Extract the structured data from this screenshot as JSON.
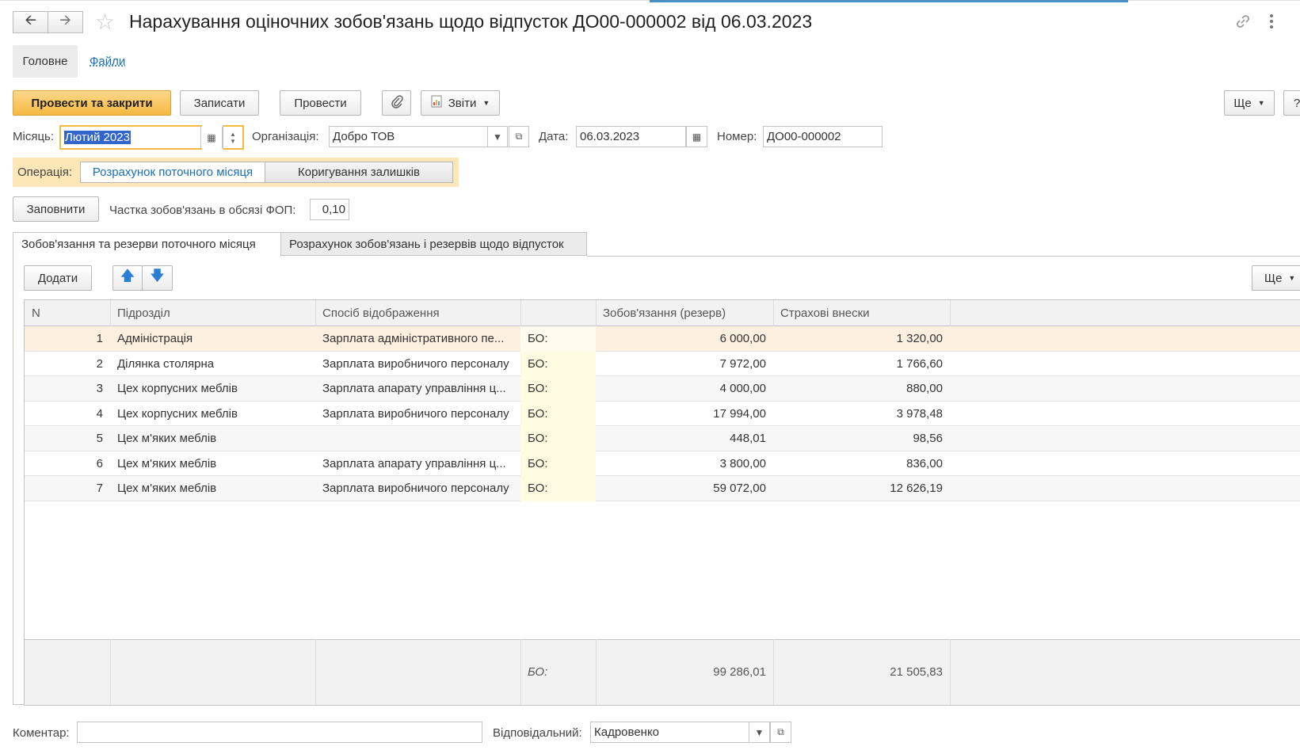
{
  "header": {
    "title": "Нарахування оціночних зобов'язань щодо відпусток ДО00-000002 від 06.03.2023"
  },
  "nav_tabs": [
    "Головне",
    "Файли"
  ],
  "toolbar": {
    "post_close": "Провести та закрити",
    "save": "Записати",
    "post": "Провести",
    "reports": "Звіти",
    "more": "Ще",
    "help": "?"
  },
  "form": {
    "month_label": "Місяць:",
    "month_value": "Лютий 2023",
    "org_label": "Організація:",
    "org_value": "Добро ТОВ",
    "date_label": "Дата:",
    "date_value": "06.03.2023",
    "number_label": "Номер:",
    "number_value": "ДО00-000002",
    "operation_label": "Операція:",
    "operation_options": [
      "Розрахунок поточного місяця",
      "Коригування залишків"
    ],
    "fill_button": "Заповнити",
    "share_label": "Частка зобов'язань в обсязі ФОП:",
    "share_value": "0,10"
  },
  "tabs": [
    "Зобов'язання та резерви поточного місяця",
    "Розрахунок зобов'язань і резервів щодо відпусток"
  ],
  "table_toolbar": {
    "add": "Додати",
    "more": "Ще"
  },
  "table": {
    "columns": [
      "N",
      "Підрозділ",
      "Спосіб відображення",
      "",
      "Зобов'язання (резерв)",
      "Страхові внески"
    ],
    "rows": [
      [
        "1",
        "Адміністрація",
        "Зарплата адміністративного пе...",
        "БО:",
        "6 000,00",
        "1 320,00"
      ],
      [
        "2",
        "Ділянка столярна",
        "Зарплата виробничого персоналу",
        "БО:",
        "7 972,00",
        "1 766,60"
      ],
      [
        "3",
        "Цех корпусних меблів",
        "Зарплата апарату управління ц...",
        "БО:",
        "4 000,00",
        "880,00"
      ],
      [
        "4",
        "Цех корпусних меблів",
        "Зарплата виробничого персоналу",
        "БО:",
        "17 994,00",
        "3 978,48"
      ],
      [
        "5",
        "Цех м'яких меблів",
        "",
        "БО:",
        "448,01",
        "98,56"
      ],
      [
        "6",
        "Цех м'яких меблів",
        "Зарплата апарату управління ц...",
        "БО:",
        "3 800,00",
        "836,00"
      ],
      [
        "7",
        "Цех м'яких меблів",
        "Зарплата виробничого персоналу",
        "БО:",
        "59 072,00",
        "12 626,19"
      ]
    ],
    "footer": {
      "label": "БО:",
      "obligation_total": "99 286,01",
      "insurance_total": "21 505,83"
    }
  },
  "bottom": {
    "comment_label": "Коментар:",
    "comment_value": "",
    "responsible_label": "Відповідальний:",
    "responsible_value": "Кадровенко"
  },
  "icons": {
    "back": "arrow-left-icon",
    "forward": "arrow-right-icon",
    "favorite": "star-icon",
    "link": "link-icon",
    "menu": "kebab-menu-icon",
    "attach": "paperclip-icon",
    "reports": "report-icon",
    "calendar": "calendar-icon",
    "dropdown": "chevron-down-icon",
    "open": "open-form-icon",
    "up": "arrow-up-icon",
    "down": "arrow-down-icon"
  },
  "colors": {
    "primary_button": "#f4b942",
    "selected_row": "#fdf0e0",
    "accent_link": "#1a6fb5",
    "bo_column": "#fffbe0"
  }
}
